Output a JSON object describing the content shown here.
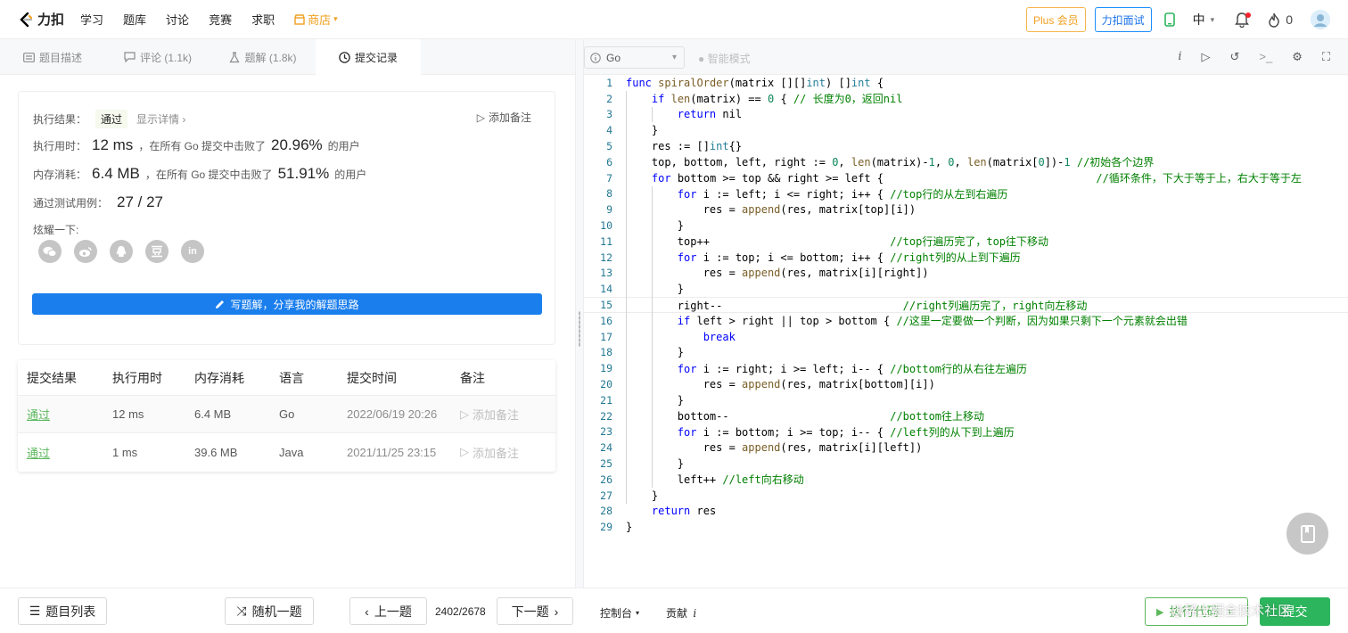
{
  "topbar": {
    "logo_text": "力扣",
    "nav": [
      "学习",
      "题库",
      "讨论",
      "竞赛",
      "求职"
    ],
    "shop": "商店",
    "plus": "Plus 会员",
    "interview": "力扣面试",
    "lang": "中",
    "streak": "0"
  },
  "tabs": [
    {
      "label": "题目描述",
      "icon": "description-icon"
    },
    {
      "label": "评论 (1.1k)",
      "icon": "comment-icon"
    },
    {
      "label": "题解 (1.8k)",
      "icon": "flask-icon"
    },
    {
      "label": "提交记录",
      "icon": "clock-icon"
    }
  ],
  "result": {
    "result_label": "执行结果：",
    "result_value": "通过",
    "detail_link": "显示详情 ›",
    "add_note": "添加备注",
    "time_label": "执行用时：",
    "time_value": "12 ms",
    "time_mid": "，在所有 Go 提交中击败了",
    "time_pct": "20.96%",
    "time_suffix": "的用户",
    "mem_label": "内存消耗：",
    "mem_value": "6.4 MB",
    "mem_mid": "，在所有 Go 提交中击败了",
    "mem_pct": "51.91%",
    "mem_suffix": "的用户",
    "tests_label": "通过测试用例：",
    "tests_value": "27 / 27",
    "share_label": "炫耀一下:",
    "share_in": "in",
    "write_btn": "写题解，分享我的解题思路"
  },
  "submissions": {
    "headers": [
      "提交结果",
      "执行用时",
      "内存消耗",
      "语言",
      "提交时间",
      "备注"
    ],
    "rows": [
      {
        "status": "通过",
        "time": "12 ms",
        "memory": "6.4 MB",
        "lang": "Go",
        "submitted": "2022/06/19 20:26",
        "note": "添加备注"
      },
      {
        "status": "通过",
        "time": "1 ms",
        "memory": "39.6 MB",
        "lang": "Java",
        "submitted": "2021/11/25 23:15",
        "note": "添加备注"
      }
    ]
  },
  "editor": {
    "language": "Go",
    "smart_mode": "智能模式",
    "current_line": 15,
    "lines": [
      "func spiralOrder(matrix [][]int) []int {",
      "    if len(matrix) == 0 { // 长度为0，返回nil",
      "        return nil",
      "    }",
      "    res := []int{}",
      "    top, bottom, left, right := 0, len(matrix)-1, 0, len(matrix[0])-1 //初始各个边界",
      "    for bottom >= top && right >= left {                                 //循环条件，下大于等于上，右大于等于左",
      "        for i := left; i <= right; i++ { //top行的从左到右遍历",
      "            res = append(res, matrix[top][i])",
      "        }",
      "        top++                            //top行遍历完了，top往下移动",
      "        for i := top; i <= bottom; i++ { //right列的从上到下遍历",
      "            res = append(res, matrix[i][right])",
      "        }",
      "        right--                            //right列遍历完了，right向左移动",
      "        if left > right || top > bottom { //这里一定要做一个判断，因为如果只剩下一个元素就会出错",
      "            break",
      "        }",
      "        for i := right; i >= left; i-- { //bottom行的从右往左遍历",
      "            res = append(res, matrix[bottom][i])",
      "        }",
      "        bottom--                         //bottom往上移动",
      "        for i := bottom; i >= top; i-- { //left列的从下到上遍历",
      "            res = append(res, matrix[i][left])",
      "        }",
      "        left++ //left向右移动",
      "    }",
      "    return res",
      "}"
    ]
  },
  "bottom": {
    "problem_list": "题目列表",
    "random": "随机一题",
    "prev": "上一题",
    "page": "2402/2678",
    "next": "下一题",
    "console": "控制台",
    "contribute": "贡献",
    "run": "执行代码",
    "submit": "提交",
    "watermark": "@稀土掘金技术社区"
  },
  "colors": {
    "accent": "#1a7eed",
    "pass": "#5cb85c",
    "submit": "#2db55d",
    "shop": "#f0a020"
  }
}
